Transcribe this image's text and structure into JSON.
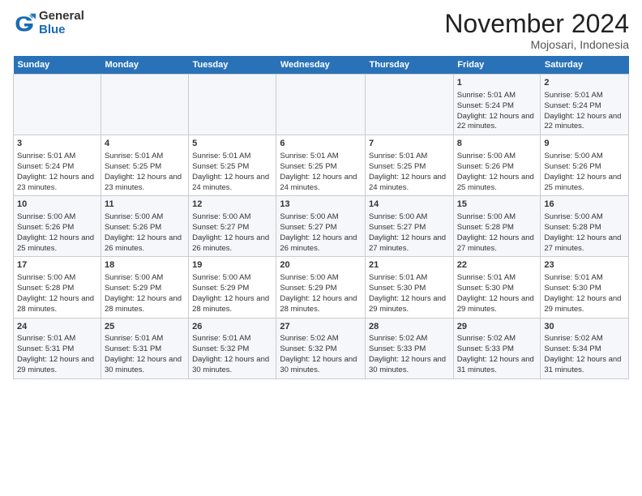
{
  "logo": {
    "general": "General",
    "blue": "Blue"
  },
  "title": "November 2024",
  "subtitle": "Mojosari, Indonesia",
  "days_header": [
    "Sunday",
    "Monday",
    "Tuesday",
    "Wednesday",
    "Thursday",
    "Friday",
    "Saturday"
  ],
  "weeks": [
    [
      {
        "day": "",
        "info": ""
      },
      {
        "day": "",
        "info": ""
      },
      {
        "day": "",
        "info": ""
      },
      {
        "day": "",
        "info": ""
      },
      {
        "day": "",
        "info": ""
      },
      {
        "day": "1",
        "info": "Sunrise: 5:01 AM\nSunset: 5:24 PM\nDaylight: 12 hours and 22 minutes."
      },
      {
        "day": "2",
        "info": "Sunrise: 5:01 AM\nSunset: 5:24 PM\nDaylight: 12 hours and 22 minutes."
      }
    ],
    [
      {
        "day": "3",
        "info": "Sunrise: 5:01 AM\nSunset: 5:24 PM\nDaylight: 12 hours and 23 minutes."
      },
      {
        "day": "4",
        "info": "Sunrise: 5:01 AM\nSunset: 5:25 PM\nDaylight: 12 hours and 23 minutes."
      },
      {
        "day": "5",
        "info": "Sunrise: 5:01 AM\nSunset: 5:25 PM\nDaylight: 12 hours and 24 minutes."
      },
      {
        "day": "6",
        "info": "Sunrise: 5:01 AM\nSunset: 5:25 PM\nDaylight: 12 hours and 24 minutes."
      },
      {
        "day": "7",
        "info": "Sunrise: 5:01 AM\nSunset: 5:25 PM\nDaylight: 12 hours and 24 minutes."
      },
      {
        "day": "8",
        "info": "Sunrise: 5:00 AM\nSunset: 5:26 PM\nDaylight: 12 hours and 25 minutes."
      },
      {
        "day": "9",
        "info": "Sunrise: 5:00 AM\nSunset: 5:26 PM\nDaylight: 12 hours and 25 minutes."
      }
    ],
    [
      {
        "day": "10",
        "info": "Sunrise: 5:00 AM\nSunset: 5:26 PM\nDaylight: 12 hours and 25 minutes."
      },
      {
        "day": "11",
        "info": "Sunrise: 5:00 AM\nSunset: 5:26 PM\nDaylight: 12 hours and 26 minutes."
      },
      {
        "day": "12",
        "info": "Sunrise: 5:00 AM\nSunset: 5:27 PM\nDaylight: 12 hours and 26 minutes."
      },
      {
        "day": "13",
        "info": "Sunrise: 5:00 AM\nSunset: 5:27 PM\nDaylight: 12 hours and 26 minutes."
      },
      {
        "day": "14",
        "info": "Sunrise: 5:00 AM\nSunset: 5:27 PM\nDaylight: 12 hours and 27 minutes."
      },
      {
        "day": "15",
        "info": "Sunrise: 5:00 AM\nSunset: 5:28 PM\nDaylight: 12 hours and 27 minutes."
      },
      {
        "day": "16",
        "info": "Sunrise: 5:00 AM\nSunset: 5:28 PM\nDaylight: 12 hours and 27 minutes."
      }
    ],
    [
      {
        "day": "17",
        "info": "Sunrise: 5:00 AM\nSunset: 5:28 PM\nDaylight: 12 hours and 28 minutes."
      },
      {
        "day": "18",
        "info": "Sunrise: 5:00 AM\nSunset: 5:29 PM\nDaylight: 12 hours and 28 minutes."
      },
      {
        "day": "19",
        "info": "Sunrise: 5:00 AM\nSunset: 5:29 PM\nDaylight: 12 hours and 28 minutes."
      },
      {
        "day": "20",
        "info": "Sunrise: 5:00 AM\nSunset: 5:29 PM\nDaylight: 12 hours and 28 minutes."
      },
      {
        "day": "21",
        "info": "Sunrise: 5:01 AM\nSunset: 5:30 PM\nDaylight: 12 hours and 29 minutes."
      },
      {
        "day": "22",
        "info": "Sunrise: 5:01 AM\nSunset: 5:30 PM\nDaylight: 12 hours and 29 minutes."
      },
      {
        "day": "23",
        "info": "Sunrise: 5:01 AM\nSunset: 5:30 PM\nDaylight: 12 hours and 29 minutes."
      }
    ],
    [
      {
        "day": "24",
        "info": "Sunrise: 5:01 AM\nSunset: 5:31 PM\nDaylight: 12 hours and 29 minutes."
      },
      {
        "day": "25",
        "info": "Sunrise: 5:01 AM\nSunset: 5:31 PM\nDaylight: 12 hours and 30 minutes."
      },
      {
        "day": "26",
        "info": "Sunrise: 5:01 AM\nSunset: 5:32 PM\nDaylight: 12 hours and 30 minutes."
      },
      {
        "day": "27",
        "info": "Sunrise: 5:02 AM\nSunset: 5:32 PM\nDaylight: 12 hours and 30 minutes."
      },
      {
        "day": "28",
        "info": "Sunrise: 5:02 AM\nSunset: 5:33 PM\nDaylight: 12 hours and 30 minutes."
      },
      {
        "day": "29",
        "info": "Sunrise: 5:02 AM\nSunset: 5:33 PM\nDaylight: 12 hours and 31 minutes."
      },
      {
        "day": "30",
        "info": "Sunrise: 5:02 AM\nSunset: 5:34 PM\nDaylight: 12 hours and 31 minutes."
      }
    ]
  ]
}
